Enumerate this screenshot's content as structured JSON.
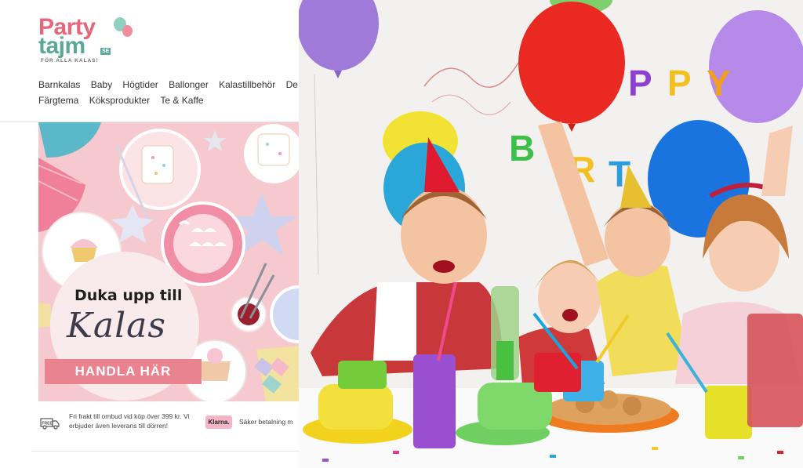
{
  "logo": {
    "line1": "Party",
    "line2": "tajm",
    "domain_badge": "SE",
    "tagline": "FÖR ALLA KALAS!",
    "colors": {
      "pink": "#e6667b",
      "green": "#5aa896"
    }
  },
  "nav": {
    "row1": [
      "Barnkalas",
      "Baby",
      "Högtider",
      "Ballonger",
      "Kalastillbehör",
      "De"
    ],
    "row2": [
      "Färgtema",
      "Köksprodukter",
      "Te & Kaffe"
    ]
  },
  "hero": {
    "line1": "Duka upp till",
    "line2": "Kalas",
    "cta": "HANDLA HÄR",
    "colors": {
      "background": "#f6c9cf",
      "cta": "#e9838f"
    }
  },
  "info_bar": {
    "truck_icon": "truck-icon",
    "truck_badge": "FREE",
    "shipping": "Fri frakt till ombud vid köp över 399 kr. Vi erbjuder även leverans till dörren!",
    "klarna": "Klarna.",
    "secure_payment": "Säker betalning m"
  },
  "photo": {
    "banner_letters": [
      "P",
      "P",
      "Y",
      "B",
      "R",
      "T"
    ]
  }
}
